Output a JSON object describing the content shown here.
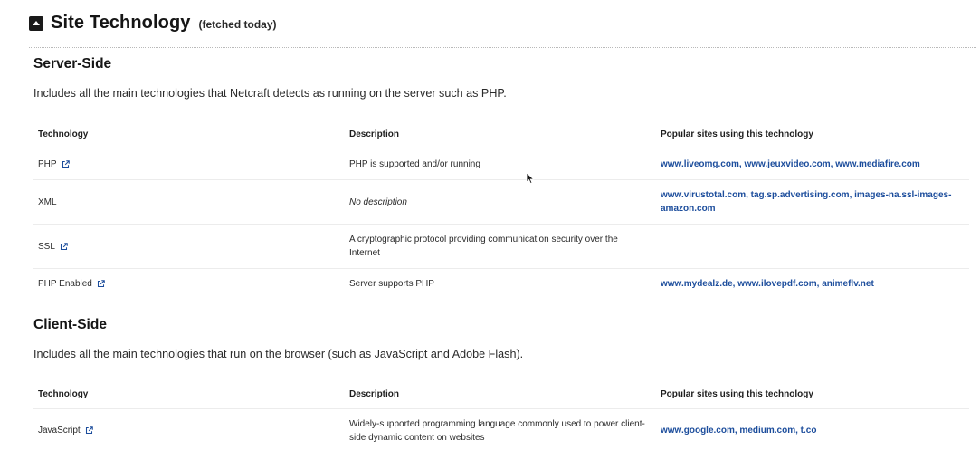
{
  "header": {
    "title": "Site Technology",
    "fetched": "(fetched today)",
    "collapse_icon": "caret-up-icon"
  },
  "table_headers": {
    "technology": "Technology",
    "description": "Description",
    "popular": "Popular sites using this technology"
  },
  "server_side": {
    "title": "Server-Side",
    "description": "Includes all the main technologies that Netcraft detects as running on the server such as PHP.",
    "rows": [
      {
        "technology": "PHP",
        "has_link": true,
        "description": "PHP is supported and/or running",
        "sites": [
          "www.liveomg.com",
          "www.jeuxvideo.com",
          "www.mediafire.com"
        ]
      },
      {
        "technology": "XML",
        "has_link": false,
        "description": "No description",
        "sites": [
          "www.virustotal.com",
          "tag.sp.advertising.com",
          "images-na.ssl-images-amazon.com"
        ]
      },
      {
        "technology": "SSL",
        "has_link": true,
        "description": "A cryptographic protocol providing communication security over the Internet",
        "sites": []
      },
      {
        "technology": "PHP Enabled",
        "has_link": true,
        "description": "Server supports PHP",
        "sites": [
          "www.mydealz.de",
          "www.ilovepdf.com",
          "animeflv.net"
        ]
      }
    ]
  },
  "client_side": {
    "title": "Client-Side",
    "description": "Includes all the main technologies that run on the browser (such as JavaScript and Adobe Flash).",
    "rows": [
      {
        "technology": "JavaScript",
        "has_link": true,
        "description": "Widely-supported programming language commonly used to power client-side dynamic content on websites",
        "sites": [
          "www.google.com",
          "medium.com",
          "t.co"
        ]
      }
    ]
  },
  "colors": {
    "link": "#1c4d9c",
    "text": "#2a2a2a",
    "rule": "#ececec"
  }
}
